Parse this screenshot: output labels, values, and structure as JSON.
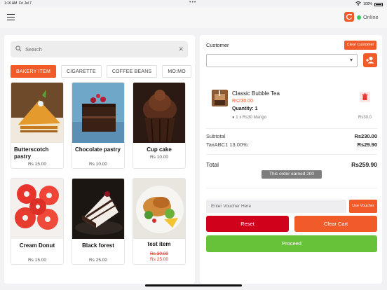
{
  "status": {
    "time": "1:16 AM",
    "date": "Fri Jul 7",
    "dots": "•••",
    "battery": "100%"
  },
  "header": {
    "online_label": "Online",
    "online_color": "#35c759",
    "accent": "#f15a29",
    "refresh_icon": "refresh-icon"
  },
  "search": {
    "placeholder": "Search",
    "value": ""
  },
  "categories": [
    "BAKERY ITEM",
    "CIGARETTE",
    "COFFEE BEANS",
    "MO:MO"
  ],
  "products": [
    {
      "name": "Butterscotch pastry",
      "price": "Rs 15.00"
    },
    {
      "name": "Chocolate pastry",
      "price": "Rs 10.00"
    },
    {
      "name": "Cup cake",
      "price": "Rs 10.00"
    },
    {
      "name": "Cream Donut",
      "price": "Rs 15.00"
    },
    {
      "name": "Black forest",
      "price": "Rs 25.00"
    },
    {
      "name": "test item",
      "old_price": "Rs 30.00",
      "price": "Rs 25.00"
    }
  ],
  "customer": {
    "label": "Customer",
    "clear_label": "Clear Customer",
    "selected": ""
  },
  "order": {
    "item_name": "Classic Bubble Tea",
    "item_price": "Rs230.00",
    "quantity": "Quantity: 1",
    "modifier": "1 x Rs30 Mango",
    "modifier_price": "Rs30.0"
  },
  "summary": {
    "subtotal_label": "Subtotal",
    "subtotal": "Rs230.00",
    "tax_label": "TaxABC1 13.00%:",
    "tax": "Rs29.90",
    "total_label": "Total",
    "total": "Rs259.90",
    "earned": "This order earned 200"
  },
  "actions": {
    "voucher_placeholder": "Enter Voucher Here",
    "use_voucher": "Use Voucher",
    "reset": "Reset",
    "clear_cart": "Clear Cart",
    "proceed": "Proceed"
  }
}
